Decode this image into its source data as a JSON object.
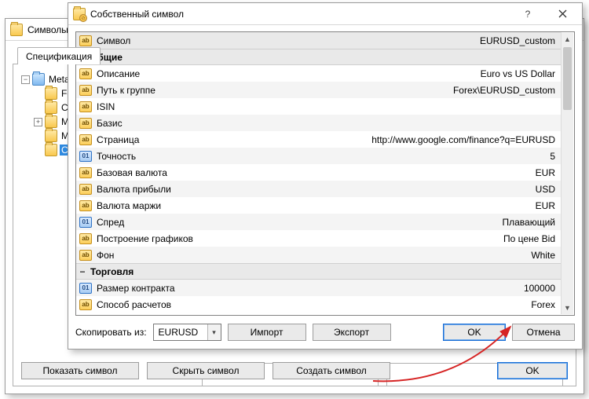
{
  "parent_window": {
    "title": "Символы",
    "tab_label": "Спецификация",
    "tree": {
      "root": "MetaTrader",
      "items": [
        {
          "label": "Forex",
          "kind": "folder"
        },
        {
          "label": "CFD",
          "kind": "folder"
        },
        {
          "label": "MOEX",
          "kind": "folder",
          "expandable": true
        },
        {
          "label": "Metals",
          "kind": "folder"
        },
        {
          "label": "Custom",
          "kind": "folder",
          "selected": true
        }
      ]
    },
    "buttons": {
      "show": "Показать символ",
      "hide": "Скрыть символ",
      "create": "Создать символ",
      "ok": "OK"
    }
  },
  "dialog": {
    "title": "Собственный символ",
    "properties": [
      {
        "group": false,
        "icon": "ab",
        "name": "Символ",
        "value": "EURUSD_custom",
        "first": true
      },
      {
        "group": true,
        "name": "Общие"
      },
      {
        "group": false,
        "icon": "ab",
        "name": "Описание",
        "value": "Euro vs US Dollar"
      },
      {
        "group": false,
        "icon": "ab",
        "name": "Путь к группе",
        "value": "Forex\\EURUSD_custom"
      },
      {
        "group": false,
        "icon": "ab",
        "name": "ISIN",
        "value": ""
      },
      {
        "group": false,
        "icon": "ab",
        "name": "Базис",
        "value": ""
      },
      {
        "group": false,
        "icon": "ab",
        "name": "Страница",
        "value": "http://www.google.com/finance?q=EURUSD"
      },
      {
        "group": false,
        "icon": "01",
        "name": "Точность",
        "value": "5"
      },
      {
        "group": false,
        "icon": "ab",
        "name": "Базовая валюта",
        "value": "EUR"
      },
      {
        "group": false,
        "icon": "ab",
        "name": "Валюта прибыли",
        "value": "USD"
      },
      {
        "group": false,
        "icon": "ab",
        "name": "Валюта маржи",
        "value": "EUR"
      },
      {
        "group": false,
        "icon": "01",
        "name": "Спред",
        "value": "Плавающий"
      },
      {
        "group": false,
        "icon": "ab",
        "name": "Построение графиков",
        "value": "По цене Bid"
      },
      {
        "group": false,
        "icon": "ab",
        "name": "Фон",
        "value": "White"
      },
      {
        "group": true,
        "name": "Торговля"
      },
      {
        "group": false,
        "icon": "01",
        "name": "Размер контракта",
        "value": "100000"
      },
      {
        "group": false,
        "icon": "ab",
        "name": "Способ расчетов",
        "value": "Forex"
      }
    ],
    "footer": {
      "copy_label": "Скопировать из:",
      "copy_value": "EURUSD",
      "import": "Импорт",
      "export": "Экспорт",
      "ok": "OK",
      "cancel": "Отмена"
    }
  }
}
